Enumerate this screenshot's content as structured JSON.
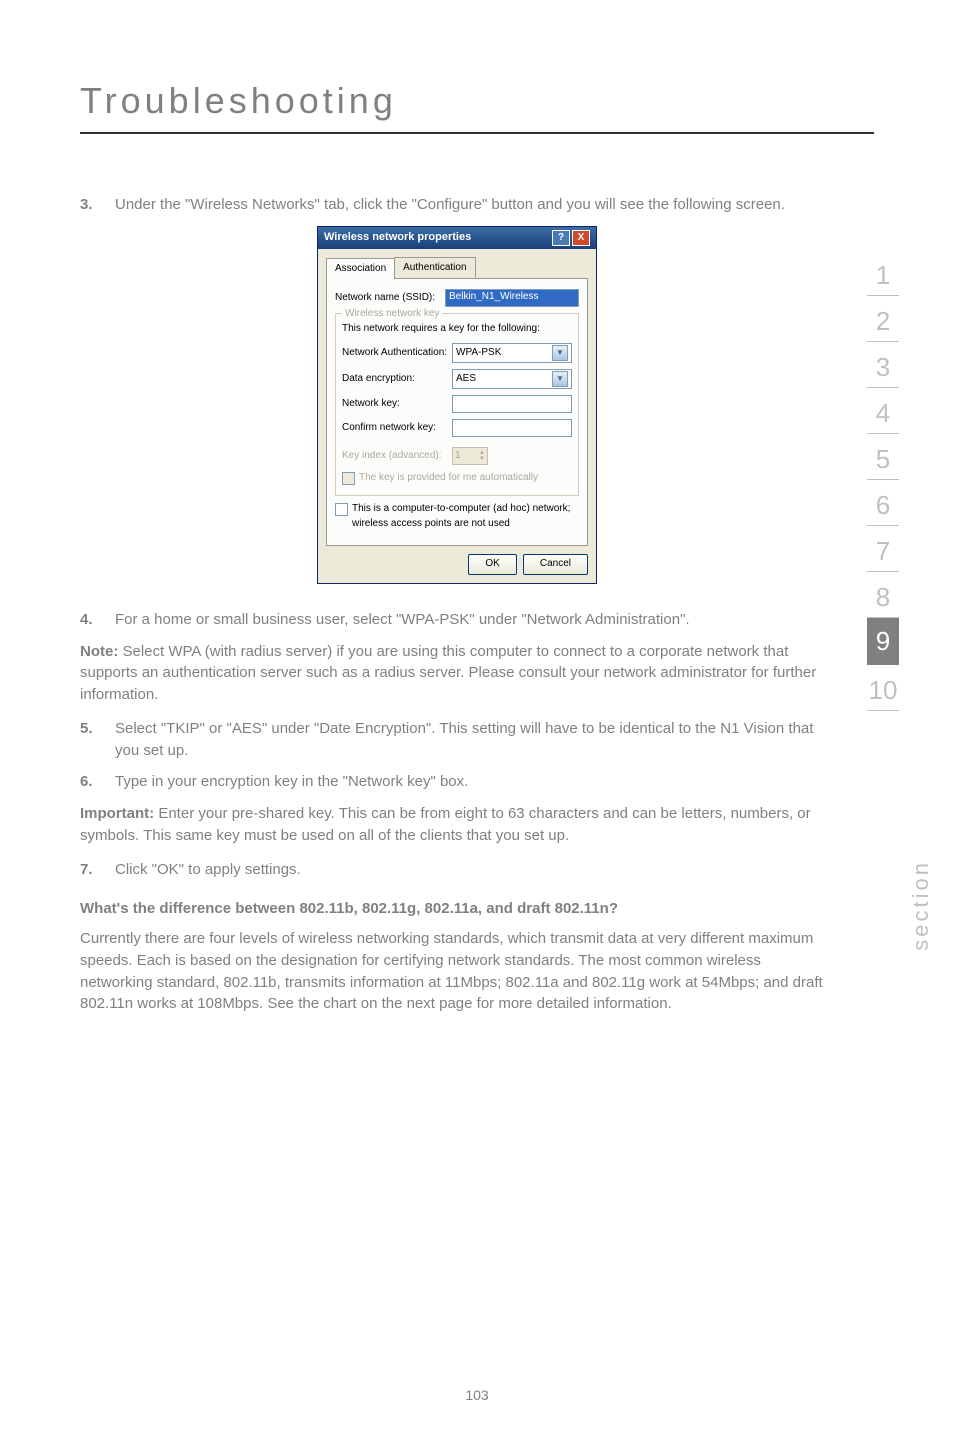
{
  "page_title": "Troubleshooting",
  "items": {
    "i3": {
      "num": "3.",
      "text": "Under the \"Wireless Networks\" tab, click the \"Configure\" button and you will see the following screen."
    },
    "i4": {
      "num": "4.",
      "text": "For a home or small business user, select \"WPA-PSK\" under \"Network Administration\"."
    },
    "i5": {
      "num": "5.",
      "text": "Select \"TKIP\" or \"AES\" under \"Date Encryption\". This setting will have to be identical to the N1 Vision that you set up."
    },
    "i6": {
      "num": "6.",
      "text": "Type in your encryption key in the \"Network key\" box."
    },
    "i7": {
      "num": "7.",
      "text": "Click \"OK\" to apply settings."
    }
  },
  "note_label": "Note:",
  "note_text": " Select WPA (with radius server) if you are using this computer to connect to a corporate network that supports an authentication server such as a radius server. Please consult your network administrator for further information.",
  "important_label": "Important:",
  "important_text": " Enter your pre-shared key. This can be from eight to 63 characters and can be letters, numbers, or symbols. This same key must be used on all of the clients that you set up.",
  "heading_q": "What's the difference between 802.11b, 802.11g, 802.11a, and draft 802.11n?",
  "final_para": "Currently there are four levels of wireless networking standards, which transmit data at very different maximum speeds. Each is based on the designation for certifying network standards. The most common wireless networking standard, 802.11b, transmits information at 11Mbps; 802.11a and 802.11g work at 54Mbps; and draft 802.11n works at 108Mbps. See the chart on the next page for more detailed information.",
  "sidebar": [
    "1",
    "2",
    "3",
    "4",
    "5",
    "6",
    "7",
    "8",
    "9",
    "10"
  ],
  "sidebar_active_index": 8,
  "section_label": "section",
  "page_number": "103",
  "dialog": {
    "title": "Wireless network properties",
    "help": "?",
    "close": "X",
    "tab1": "Association",
    "tab2": "Authentication",
    "ssid_label": "Network name (SSID):",
    "ssid_value": "Belkin_N1_Wireless",
    "group_title": "Wireless network key",
    "group_sub": "This network requires a key for the following:",
    "auth_label": "Network Authentication:",
    "auth_value": "WPA-PSK",
    "enc_label": "Data encryption:",
    "enc_value": "AES",
    "netkey_label": "Network key:",
    "confirm_label": "Confirm network key:",
    "keyindex_label": "Key index (advanced):",
    "keyindex_value": "1",
    "auto_key": "The key is provided for me automatically",
    "adhoc": "This is a computer-to-computer (ad hoc) network; wireless access points are not used",
    "ok": "OK",
    "cancel": "Cancel"
  }
}
